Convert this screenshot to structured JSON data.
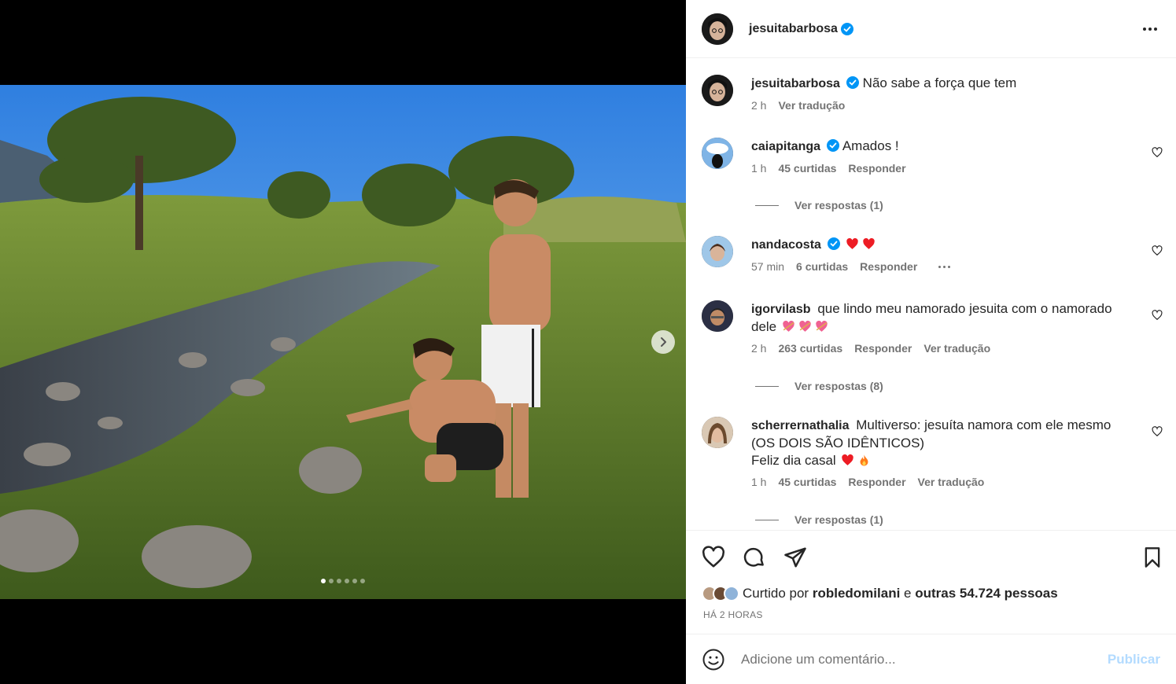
{
  "post": {
    "author": "jesuitabarbosa",
    "caption": "Não sabe a força que tem",
    "caption_time": "2 h",
    "translate_label": "Ver tradução",
    "carousel_count": 6,
    "carousel_active": 0
  },
  "comments": [
    {
      "user": "caiapitanga",
      "verified": true,
      "text": "Amados !",
      "time": "1 h",
      "likes": "45 curtidas",
      "reply": "Responder",
      "view_replies": "Ver respostas (1)"
    },
    {
      "user": "nandacosta",
      "verified": true,
      "text": "",
      "emoji": [
        "red-heart",
        "red-heart"
      ],
      "time": "57 min",
      "likes": "6 curtidas",
      "reply": "Responder"
    },
    {
      "user": "igorvilasb",
      "verified": false,
      "text": "que lindo meu namorado jesuita com o namorado dele",
      "emoji": [
        "heart-arrow",
        "heart-arrow",
        "heart-arrow"
      ],
      "time": "2 h",
      "likes": "263 curtidas",
      "reply": "Responder",
      "translate": "Ver tradução",
      "view_replies": "Ver respostas (8)"
    },
    {
      "user": "scherrernathalia",
      "verified": false,
      "text": "Multiverso: jesuíta namora com ele mesmo (OS DOIS SÃO IDÊNTICOS)",
      "text2": "Feliz dia casal",
      "emoji": [
        "red-heart",
        "fire"
      ],
      "time": "1 h",
      "likes": "45 curtidas",
      "reply": "Responder",
      "translate": "Ver tradução",
      "view_replies": "Ver respostas (1)"
    }
  ],
  "likes": {
    "prefix": "Curtido por",
    "user": "robledomilani",
    "joiner": "e",
    "others": "outras 54.724 pessoas"
  },
  "posted_ago": "HÁ 2 HORAS",
  "composer": {
    "placeholder": "Adicione um comentário...",
    "publish": "Publicar"
  },
  "colors": {
    "verified": "#0095f6",
    "heart": "#ed1c24",
    "publish": "#b3dbff"
  }
}
